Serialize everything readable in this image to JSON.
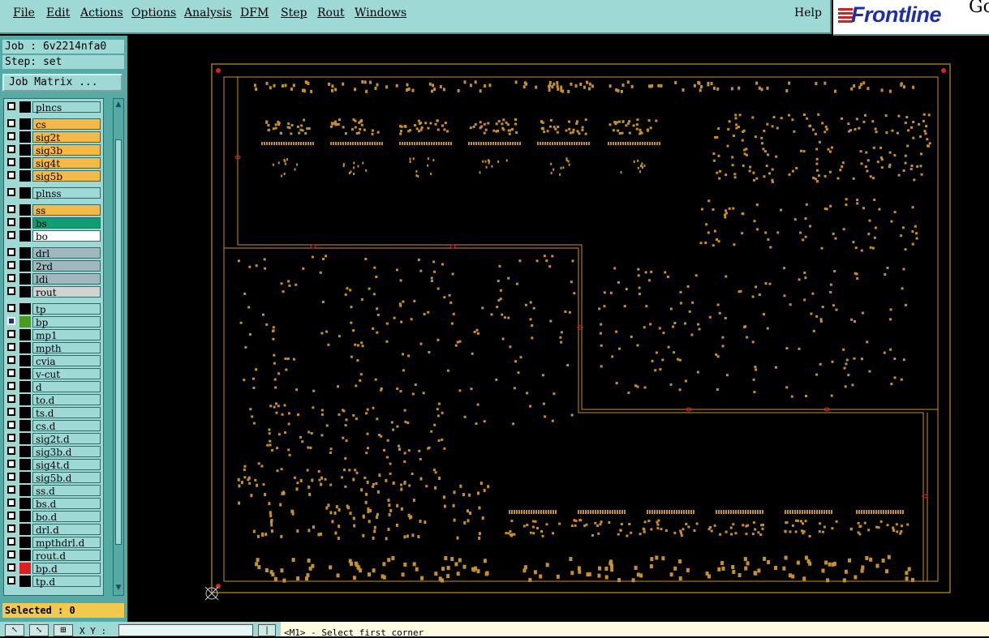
{
  "menu": {
    "items": [
      "File",
      "Edit",
      "Actions",
      "Options",
      "Analysis",
      "DFM",
      "Step",
      "Rout",
      "Windows"
    ],
    "help": "Help"
  },
  "logo": {
    "text": "Frontline",
    "extra": "Go"
  },
  "job": {
    "label": "Job : 6v2214nfa0",
    "step": "Step: set"
  },
  "job_matrix_button": "Job Matrix ...",
  "layers": [
    {
      "name": "plncs",
      "swatch": "#000000",
      "bg": "#9fd9d6"
    },
    {
      "name": "cs",
      "swatch": "#000000",
      "bg": "#f5b94a"
    },
    {
      "name": "sig2t",
      "swatch": "#000000",
      "bg": "#f5b94a"
    },
    {
      "name": "sig3b",
      "swatch": "#000000",
      "bg": "#f5b94a"
    },
    {
      "name": "sig4t",
      "swatch": "#000000",
      "bg": "#f5b94a"
    },
    {
      "name": "sig5b",
      "swatch": "#000000",
      "bg": "#f5b94a"
    },
    {
      "name": "plnss",
      "swatch": "#000000",
      "bg": "#9fd9d6"
    },
    {
      "name": "ss",
      "swatch": "#000000",
      "bg": "#f5b94a"
    },
    {
      "name": "bs",
      "swatch": "#000000",
      "bg": "#0f9e73"
    },
    {
      "name": "bo",
      "swatch": "#000000",
      "bg": "#ffffff"
    },
    {
      "name": "drl",
      "swatch": "#000000",
      "bg": "#9fb7bd"
    },
    {
      "name": "2rd",
      "swatch": "#000000",
      "bg": "#9fb7bd"
    },
    {
      "name": "ldi",
      "swatch": "#000000",
      "bg": "#9fb7bd"
    },
    {
      "name": "rout",
      "swatch": "#000000",
      "bg": "#d3d3d3"
    },
    {
      "name": "tp",
      "swatch": "#000000",
      "bg": "#9fd9d6"
    },
    {
      "name": "bp",
      "swatch": "#4a9a1e",
      "bg": "#9fd9d6",
      "active": true
    },
    {
      "name": "mp1",
      "swatch": "#000000",
      "bg": "#9fd9d6"
    },
    {
      "name": "mpth",
      "swatch": "#000000",
      "bg": "#9fd9d6"
    },
    {
      "name": "cvia",
      "swatch": "#000000",
      "bg": "#9fd9d6"
    },
    {
      "name": "v-cut",
      "swatch": "#000000",
      "bg": "#9fd9d6"
    },
    {
      "name": "d",
      "swatch": "#000000",
      "bg": "#9fd9d6"
    },
    {
      "name": "to.d",
      "swatch": "#000000",
      "bg": "#9fd9d6"
    },
    {
      "name": "ts.d",
      "swatch": "#000000",
      "bg": "#9fd9d6"
    },
    {
      "name": "cs.d",
      "swatch": "#000000",
      "bg": "#9fd9d6"
    },
    {
      "name": "sig2t.d",
      "swatch": "#000000",
      "bg": "#9fd9d6"
    },
    {
      "name": "sig3b.d",
      "swatch": "#000000",
      "bg": "#9fd9d6"
    },
    {
      "name": "sig4t.d",
      "swatch": "#000000",
      "bg": "#9fd9d6"
    },
    {
      "name": "sig5b.d",
      "swatch": "#000000",
      "bg": "#9fd9d6"
    },
    {
      "name": "ss.d",
      "swatch": "#000000",
      "bg": "#9fd9d6"
    },
    {
      "name": "bs.d",
      "swatch": "#000000",
      "bg": "#9fd9d6"
    },
    {
      "name": "bo.d",
      "swatch": "#000000",
      "bg": "#9fd9d6"
    },
    {
      "name": "drl.d",
      "swatch": "#000000",
      "bg": "#9fd9d6"
    },
    {
      "name": "mpthdrl.d",
      "swatch": "#000000",
      "bg": "#9fd9d6"
    },
    {
      "name": "rout.d",
      "swatch": "#000000",
      "bg": "#9fd9d6"
    },
    {
      "name": "bp.d",
      "swatch": "#e0201e",
      "bg": "#9fd9d6"
    },
    {
      "name": "tp.d",
      "swatch": "#000000",
      "bg": "#9fd9d6"
    }
  ],
  "selected": "Selected : 0",
  "coords": {
    "label": "X Y :",
    "value": ""
  },
  "status": "<M1> - Select first corner",
  "colors": {
    "panel": "#9fd9d6",
    "trace": "#c8902a",
    "marker": "#e0201e"
  }
}
